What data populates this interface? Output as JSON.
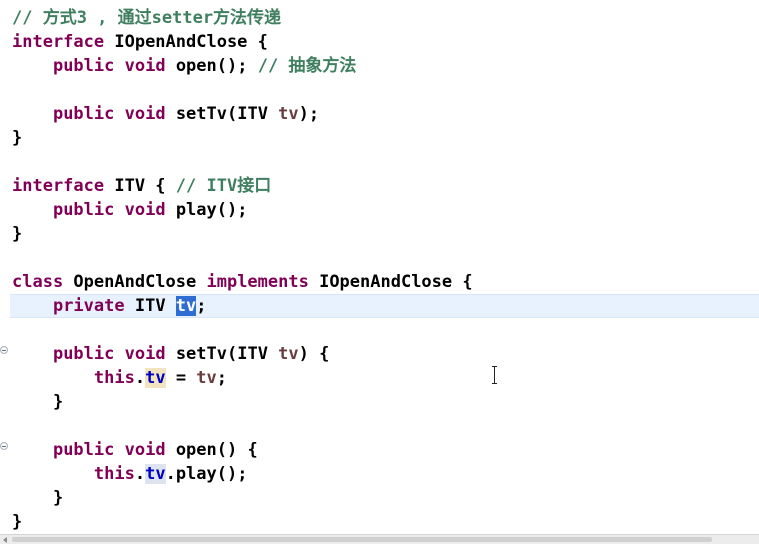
{
  "editor": {
    "lines": [
      {
        "tokens": [
          {
            "t": "// 方式3 , 通过setter方法传递",
            "c": "cm"
          }
        ]
      },
      {
        "tokens": [
          {
            "t": "interface",
            "c": "kw"
          },
          {
            "t": " IOpenAndClose {"
          }
        ]
      },
      {
        "tokens": [
          {
            "t": "    "
          },
          {
            "t": "public",
            "c": "kw"
          },
          {
            "t": " "
          },
          {
            "t": "void",
            "c": "kw"
          },
          {
            "t": " open(); "
          },
          {
            "t": "// 抽象方法",
            "c": "cm"
          }
        ]
      },
      {
        "tokens": []
      },
      {
        "tokens": [
          {
            "t": "    "
          },
          {
            "t": "public",
            "c": "kw"
          },
          {
            "t": " "
          },
          {
            "t": "void",
            "c": "kw"
          },
          {
            "t": " setTv(ITV "
          },
          {
            "t": "tv",
            "c": "var"
          },
          {
            "t": ");"
          }
        ]
      },
      {
        "tokens": [
          {
            "t": "}"
          }
        ]
      },
      {
        "tokens": []
      },
      {
        "tokens": [
          {
            "t": "interface",
            "c": "kw"
          },
          {
            "t": " ITV { "
          },
          {
            "t": "// ITV接口",
            "c": "cm"
          }
        ]
      },
      {
        "tokens": [
          {
            "t": "    "
          },
          {
            "t": "public",
            "c": "kw"
          },
          {
            "t": " "
          },
          {
            "t": "void",
            "c": "kw"
          },
          {
            "t": " play();"
          }
        ]
      },
      {
        "tokens": [
          {
            "t": "}"
          }
        ]
      },
      {
        "tokens": []
      },
      {
        "tokens": [
          {
            "t": "class",
            "c": "kw"
          },
          {
            "t": " OpenAndClose "
          },
          {
            "t": "implements",
            "c": "kw"
          },
          {
            "t": " IOpenAndClose {"
          }
        ]
      },
      {
        "tokens": [
          {
            "t": "    "
          },
          {
            "t": "private",
            "c": "kw"
          },
          {
            "t": " ITV "
          },
          {
            "t": "tv",
            "c": "fld sel"
          },
          {
            "t": ";"
          }
        ]
      },
      {
        "tokens": []
      },
      {
        "tokens": [
          {
            "t": "    "
          },
          {
            "t": "public",
            "c": "kw"
          },
          {
            "t": " "
          },
          {
            "t": "void",
            "c": "kw"
          },
          {
            "t": " setTv(ITV "
          },
          {
            "t": "tv",
            "c": "var"
          },
          {
            "t": ") {"
          }
        ]
      },
      {
        "tokens": [
          {
            "t": "        "
          },
          {
            "t": "this",
            "c": "kw"
          },
          {
            "t": "."
          },
          {
            "t": "tv",
            "c": "fld occ"
          },
          {
            "t": " = "
          },
          {
            "t": "tv",
            "c": "var"
          },
          {
            "t": ";"
          }
        ]
      },
      {
        "tokens": [
          {
            "t": "    }"
          }
        ]
      },
      {
        "tokens": []
      },
      {
        "tokens": [
          {
            "t": "    "
          },
          {
            "t": "public",
            "c": "kw"
          },
          {
            "t": " "
          },
          {
            "t": "void",
            "c": "kw"
          },
          {
            "t": " open() {"
          }
        ]
      },
      {
        "tokens": [
          {
            "t": "        "
          },
          {
            "t": "this",
            "c": "kw"
          },
          {
            "t": "."
          },
          {
            "t": "tv",
            "c": "fld occ2"
          },
          {
            "t": ".play();"
          }
        ]
      },
      {
        "tokens": [
          {
            "t": "    }"
          }
        ]
      },
      {
        "tokens": [
          {
            "t": "}"
          }
        ]
      }
    ],
    "current_line": 12,
    "fold_markers": [
      14,
      18
    ]
  },
  "colors": {
    "keyword": "#7f0055",
    "comment": "#3f7f5f",
    "field": "#0000c0",
    "parameter": "#6a3e3e",
    "selection": "#2e6ed3",
    "current_line": "#e8f2fe"
  },
  "icons": {
    "fold": "fold-collapse-icon",
    "cursor": "ibeam-cursor-icon",
    "scroll_left": "scroll-left-arrow-icon"
  }
}
